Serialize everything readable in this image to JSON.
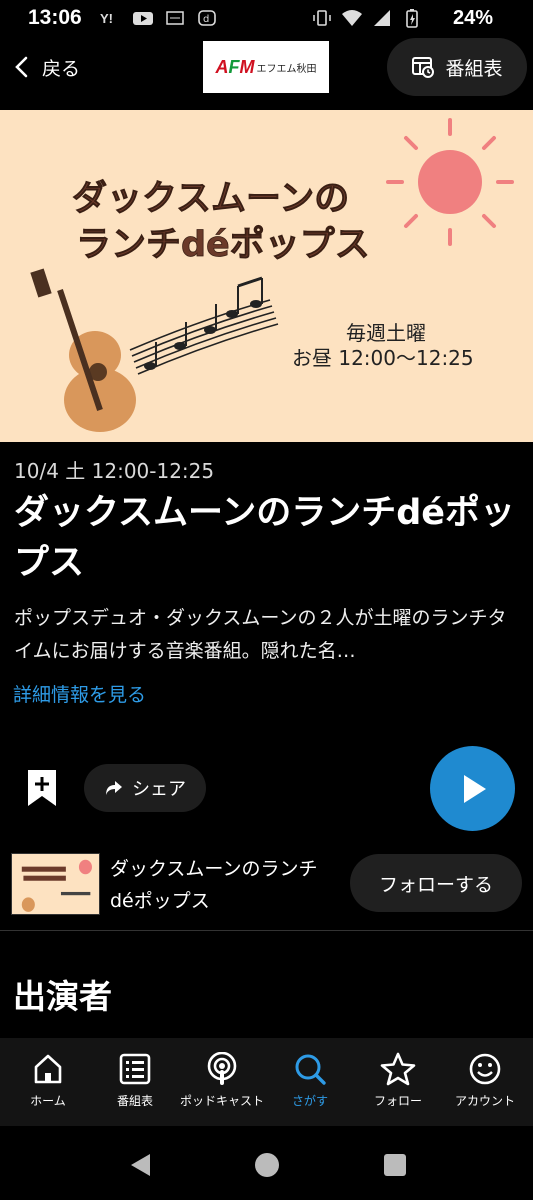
{
  "status": {
    "time": "13:06",
    "battery": "24%"
  },
  "topbar": {
    "back_label": "戻る",
    "logo_mark": "AFM",
    "logo_text": "エフエム秋田",
    "schedule_label": "番組表"
  },
  "hero": {
    "title_line1": "ダックスムーンの",
    "title_line2": "ランチdéポップス",
    "day": "毎週土曜",
    "time": "お昼 12:00〜12:25"
  },
  "episode": {
    "date": "10/4 土 12:00-12:25",
    "title": "ダックスムーンのランチdéポップス",
    "description": "ポップスデュオ・ダックスムーンの２人が土曜のランチタイムにお届けする音楽番組。隠れた名…",
    "more_label": "詳細情報を見る"
  },
  "actions": {
    "share_label": "シェア"
  },
  "series": {
    "name": "ダックスムーンのランチdéポップス",
    "follow_label": "フォローする"
  },
  "section": {
    "cast_heading": "出演者"
  },
  "nav": {
    "items": [
      {
        "label": "ホーム",
        "icon": "home-icon"
      },
      {
        "label": "番組表",
        "icon": "list-icon"
      },
      {
        "label": "ポッドキャスト",
        "icon": "podcast-icon"
      },
      {
        "label": "さがす",
        "icon": "search-icon",
        "active": true
      },
      {
        "label": "フォロー",
        "icon": "star-icon"
      },
      {
        "label": "アカウント",
        "icon": "smile-icon"
      }
    ]
  },
  "colors": {
    "accent": "#2e9be6",
    "play": "#1f8ad0",
    "hero_bg": "#fde2c1",
    "hero_title": "#6b3a2a"
  }
}
